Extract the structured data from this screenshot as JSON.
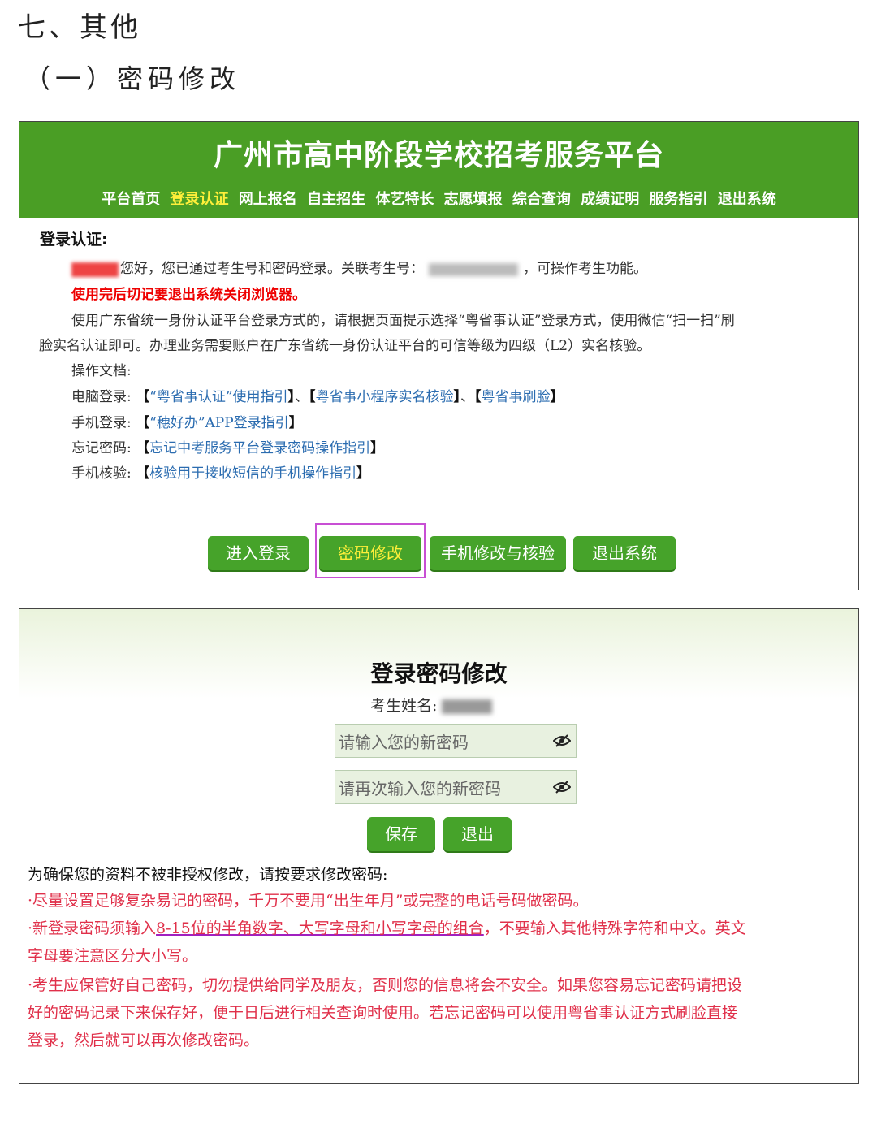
{
  "doc": {
    "heading": "七、其他",
    "subheading": "（一）密码修改"
  },
  "panel1": {
    "title": "广州市高中阶段学校招考服务平台",
    "nav": [
      "平台首页",
      "登录认证",
      "网上报名",
      "自主招生",
      "体艺特长",
      "志愿填报",
      "综合查询",
      "成绩证明",
      "服务指引",
      "退出系统"
    ],
    "nav_active": "登录认证",
    "section_title": "登录认证:",
    "greeting_pre": "您好，您已通过考生号和密码登录。关联考生号：",
    "greeting_post": "，可操作考生功能。",
    "warning": "使用完后切记要退出系统关闭浏览器。",
    "para1": "使用广东省统一身份认证平台登录方式的，请根据页面提示选择“粤省事认证”登录方式，使用微信“扫一扫”刷",
    "para2": "脸实名认证即可。办理业务需要账户在广东省统一身份认证平台的可信等级为四级（L2）实名核验。",
    "docs_label": "操作文档:",
    "pc_label": "电脑登录:",
    "pc_links": [
      "“粤省事认证”使用指引",
      "粤省事小程序实名核验",
      "粤省事刷脸"
    ],
    "mobile_label": "手机登录:",
    "mobile_link": "“穗好办”APP登录指引",
    "forgot_label": "忘记密码:",
    "forgot_link": "忘记中考服务平台登录密码操作指引",
    "phone_label": "手机核验:",
    "phone_link": "核验用于接收短信的手机操作指引",
    "buttons": {
      "login": "进入登录",
      "change_pw": "密码修改",
      "phone": "手机修改与核验",
      "exit": "退出系统"
    },
    "colors": {
      "header_green": "#4a9e25",
      "active_yellow": "#ffef3a",
      "highlight": "#c84fd4"
    }
  },
  "panel2": {
    "title": "登录密码修改",
    "name_label": "考生姓名:",
    "new_pw_placeholder": "请输入您的新密码",
    "confirm_pw_placeholder": "请再次输入您的新密码",
    "save": "保存",
    "exit": "退出",
    "notes_title": "为确保您的资料不被非授权修改，请按要求修改密码:",
    "note1": "·尽量设置足够复杂易记的密码，千万不要用“出生年月”或完整的电话号码做密码。",
    "note2_pre": "·新登录密码须输入",
    "note2_ul": "8-15位的半角数字、大写字母和小写字母的组合",
    "note2_post": "，不要输入其他特殊字符和中文。英文",
    "note2_cont": "字母要注意区分大小写。",
    "note3_a": "·考生应保管好自己密码，切勿提供给同学及朋友，否则您的信息将会不安全。如果您容易忘记密码请把设",
    "note3_b": "好的密码记录下来保存好，便于日后进行相关查询时使用。若忘记密码可以使用粤省事认证方式刷脸直接",
    "note3_c": "登录，然后就可以再次修改密码。"
  }
}
